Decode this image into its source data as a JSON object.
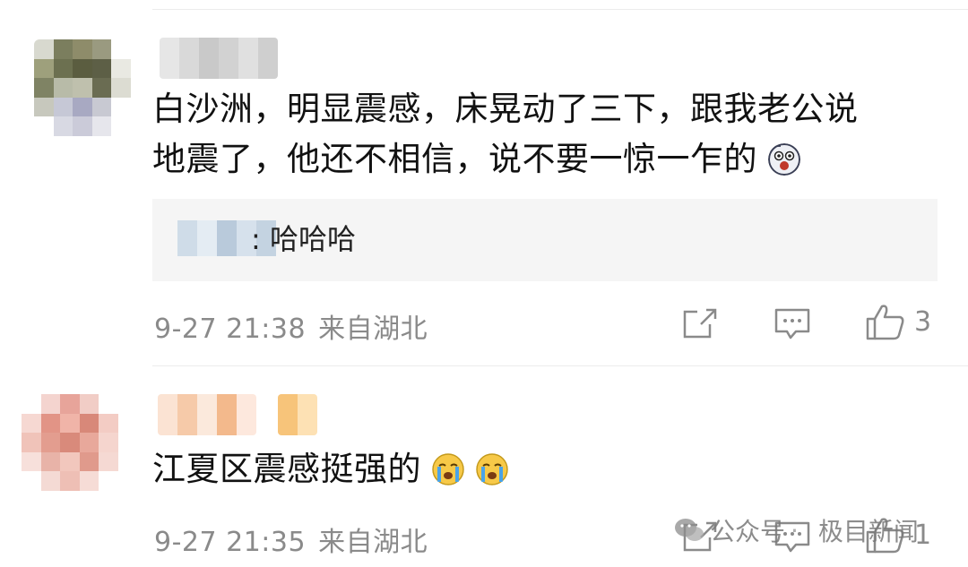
{
  "comments": [
    {
      "text_line1": "白沙洲，明显震感，床晃动了三下，跟我老公说",
      "text_line2": "地震了，他还不相信，说不要一惊一乍的",
      "emoji": "shocked-face-emoji",
      "reply": {
        "text": ": 哈哈哈"
      },
      "timestamp": "9-27 21:38",
      "location": "来自湖北",
      "like_count": "3"
    },
    {
      "text": "江夏区震感挺强的",
      "emoji": "crying-face-emoji",
      "timestamp": "9-27 21:35",
      "location": "来自湖北",
      "like_count": "1"
    }
  ],
  "icons": {
    "share": "share-icon",
    "comment": "comment-icon",
    "like": "thumbs-up-icon",
    "wechat": "wechat-icon"
  },
  "watermark": {
    "account": "公众号",
    "source": "极目新闻"
  },
  "colors": {
    "text": "#111111",
    "meta": "#8a8a8a",
    "reply_bg": "#f5f5f5",
    "divider": "#ececec"
  }
}
